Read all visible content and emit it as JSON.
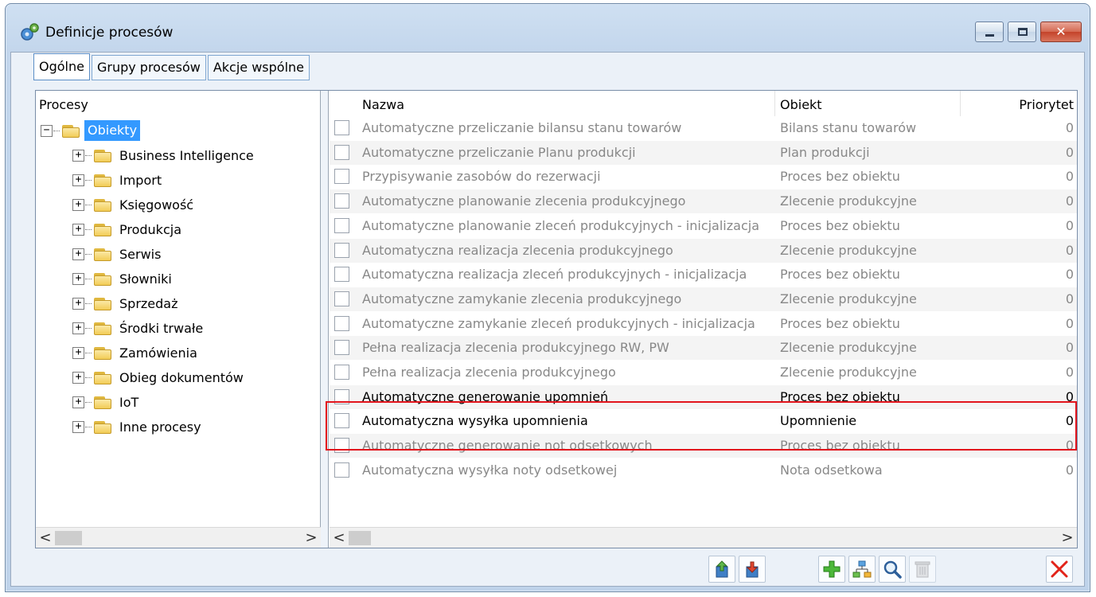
{
  "window": {
    "title": "Definicje procesów",
    "controls": {
      "minimize": "minimize",
      "maximize": "maximize",
      "close": "close"
    }
  },
  "tabs": [
    {
      "label": "Ogólne",
      "active": true
    },
    {
      "label": "Grupy procesów",
      "active": false
    },
    {
      "label": "Akcje wspólne",
      "active": false
    }
  ],
  "tree": {
    "header": "Procesy",
    "root": {
      "label": "Obiekty",
      "expander": "−",
      "selected": true
    },
    "children": [
      {
        "label": "Business Intelligence",
        "expander": "+"
      },
      {
        "label": "Import",
        "expander": "+"
      },
      {
        "label": "Księgowość",
        "expander": "+"
      },
      {
        "label": "Produkcja",
        "expander": "+"
      },
      {
        "label": "Serwis",
        "expander": "+"
      },
      {
        "label": "Słowniki",
        "expander": "+"
      },
      {
        "label": "Sprzedaż",
        "expander": "+"
      },
      {
        "label": "Środki trwałe",
        "expander": "+"
      },
      {
        "label": "Zamówienia",
        "expander": "+"
      },
      {
        "label": "Obieg dokumentów",
        "expander": "+"
      },
      {
        "label": "IoT",
        "expander": "+"
      },
      {
        "label": "Inne procesy",
        "expander": "+"
      }
    ]
  },
  "grid": {
    "columns": {
      "name": "Nazwa",
      "object": "Obiekt",
      "priority": "Priorytet"
    },
    "rows": [
      {
        "name": "Automatyczne przeliczanie bilansu stanu towarów",
        "object": "Bilans stanu towarów",
        "priority": "0",
        "highlighted": false
      },
      {
        "name": "Automatyczne przeliczanie Planu produkcji",
        "object": "Plan produkcji",
        "priority": "0",
        "highlighted": false
      },
      {
        "name": "Przypisywanie zasobów do rezerwacji",
        "object": "Proces bez obiektu",
        "priority": "0",
        "highlighted": false
      },
      {
        "name": "Automatyczne planowanie zlecenia produkcyjnego",
        "object": "Zlecenie produkcyjne",
        "priority": "0",
        "highlighted": false
      },
      {
        "name": "Automatyczne planowanie zleceń produkcyjnych - inicjalizacja",
        "object": "Proces bez obiektu",
        "priority": "0",
        "highlighted": false
      },
      {
        "name": "Automatyczna realizacja zlecenia produkcyjnego",
        "object": "Zlecenie produkcyjne",
        "priority": "0",
        "highlighted": false
      },
      {
        "name": "Automatyczna realizacja zleceń produkcyjnych - inicjalizacja",
        "object": "Proces bez obiektu",
        "priority": "0",
        "highlighted": false
      },
      {
        "name": "Automatyczne zamykanie zlecenia produkcyjnego",
        "object": "Zlecenie produkcyjne",
        "priority": "0",
        "highlighted": false
      },
      {
        "name": "Automatyczne zamykanie zleceń produkcyjnych - inicjalizacja",
        "object": "Proces bez obiektu",
        "priority": "0",
        "highlighted": false
      },
      {
        "name": "Pełna realizacja zlecenia produkcyjnego RW, PW",
        "object": "Zlecenie produkcyjne",
        "priority": "0",
        "highlighted": false
      },
      {
        "name": "Pełna realizacja zlecenia produkcyjnego",
        "object": "Zlecenie produkcyjne",
        "priority": "0",
        "highlighted": false
      },
      {
        "name": "Automatyczne generowanie upomnień",
        "object": "Proces bez obiektu",
        "priority": "0",
        "highlighted": true
      },
      {
        "name": "Automatyczna wysyłka upomnienia",
        "object": "Upomnienie",
        "priority": "0",
        "highlighted": true
      },
      {
        "name": "Automatyczne generowanie not odsetkowych",
        "object": "Proces bez obiektu",
        "priority": "0",
        "highlighted": false
      },
      {
        "name": "Automatyczna wysyłka noty odsetkowej",
        "object": "Nota odsetkowa",
        "priority": "0",
        "highlighted": false
      }
    ]
  },
  "scrollbars": {
    "left_arrow": "<",
    "right_arrow": ">"
  },
  "toolbar": {
    "buttons": [
      {
        "icon": "export-icon"
      },
      {
        "icon": "import-icon"
      },
      {
        "icon": "add-icon"
      },
      {
        "icon": "structure-icon"
      },
      {
        "icon": "search-icon"
      },
      {
        "icon": "delete-icon",
        "disabled": true
      },
      {
        "icon": "close-icon"
      }
    ]
  },
  "colors": {
    "highlight_border": "#e2141c",
    "selection": "#3399ff",
    "disabled_text": "#888888"
  }
}
